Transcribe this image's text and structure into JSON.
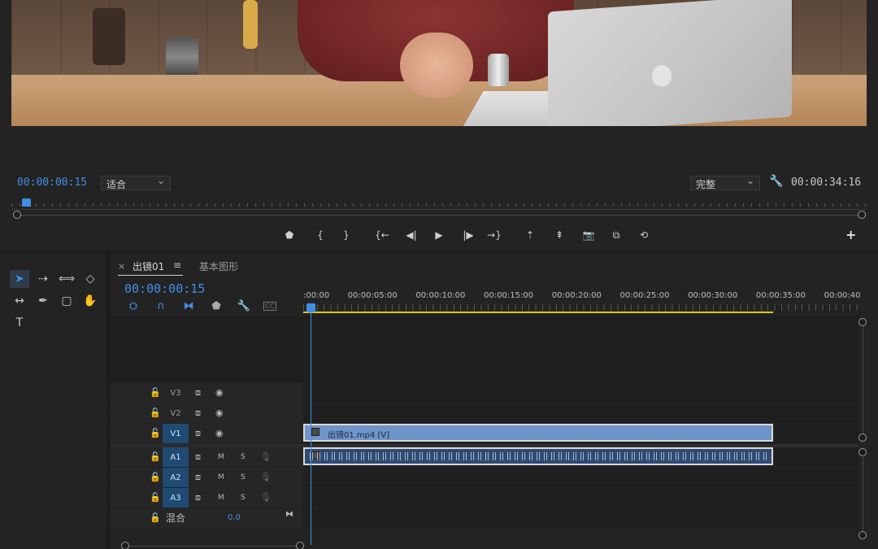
{
  "monitor": {
    "current_timecode": "00:00:00:15",
    "zoom_dropdown": "适合",
    "quality_dropdown": "完整",
    "duration_timecode": "00:00:34:16",
    "controls": [
      {
        "name": "add-marker-icon",
        "glyph": "⬟"
      },
      {
        "name": "mark-in-icon",
        "glyph": "{"
      },
      {
        "name": "mark-out-icon",
        "glyph": "}"
      },
      {
        "name": "go-to-in-icon",
        "glyph": "{←"
      },
      {
        "name": "step-back-icon",
        "glyph": "◀|"
      },
      {
        "name": "play-icon",
        "glyph": "▶"
      },
      {
        "name": "step-forward-icon",
        "glyph": "|▶"
      },
      {
        "name": "go-to-out-icon",
        "glyph": "→}"
      },
      {
        "name": "lift-icon",
        "glyph": "⇡"
      },
      {
        "name": "extract-icon",
        "glyph": "⇞"
      },
      {
        "name": "export-frame-icon",
        "glyph": "📷"
      },
      {
        "name": "compare-view-icon",
        "glyph": "⧉"
      },
      {
        "name": "toggle-proxies-icon",
        "glyph": "⟲"
      }
    ],
    "add_button": "+"
  },
  "tools": [
    {
      "name": "selection-tool-icon",
      "glyph": "➤",
      "active": true
    },
    {
      "name": "track-select-tool-icon",
      "glyph": "⇢"
    },
    {
      "name": "ripple-edit-tool-icon",
      "glyph": "⟺"
    },
    {
      "name": "razor-tool-icon",
      "glyph": "◇"
    },
    {
      "name": "slip-tool-icon",
      "glyph": "↔"
    },
    {
      "name": "pen-tool-icon",
      "glyph": "✒"
    },
    {
      "name": "rectangle-tool-icon",
      "glyph": "▢"
    },
    {
      "name": "hand-tool-icon",
      "glyph": "✋"
    },
    {
      "name": "type-tool-icon",
      "glyph": "T"
    }
  ],
  "timeline": {
    "tabs": [
      {
        "label": "出镜01",
        "close": "×",
        "menu": "≡",
        "active": true
      },
      {
        "label": "基本图形",
        "active": false
      }
    ],
    "timecode": "00:00:00:15",
    "toolbar": [
      {
        "name": "nest-icon",
        "glyph": "⛭"
      },
      {
        "name": "snap-icon",
        "glyph": "∩"
      },
      {
        "name": "linked-selection-icon",
        "glyph": "⧓"
      },
      {
        "name": "add-marker-icon",
        "glyph": "⬟"
      },
      {
        "name": "timeline-settings-icon",
        "glyph": "🔧"
      },
      {
        "name": "captions-icon",
        "glyph": "CC"
      }
    ],
    "ruler_labels": [
      ":00:00",
      "00:00:05:00",
      "00:00:10:00",
      "00:00:15:00",
      "00:00:20:00",
      "00:00:25:00",
      "00:00:30:00",
      "00:00:35:00",
      "00:00:40"
    ],
    "video_tracks": [
      {
        "name": "V3",
        "target": false
      },
      {
        "name": "V2",
        "target": false
      },
      {
        "name": "V1",
        "target": true
      }
    ],
    "audio_tracks": [
      {
        "name": "A1",
        "mute": "M",
        "solo": "S"
      },
      {
        "name": "A2",
        "mute": "M",
        "solo": "S"
      },
      {
        "name": "A3",
        "mute": "M",
        "solo": "S"
      }
    ],
    "mix": {
      "label": "混合",
      "value": "0.0"
    },
    "video_clip_label": "出镜01.mp4 [V]"
  }
}
